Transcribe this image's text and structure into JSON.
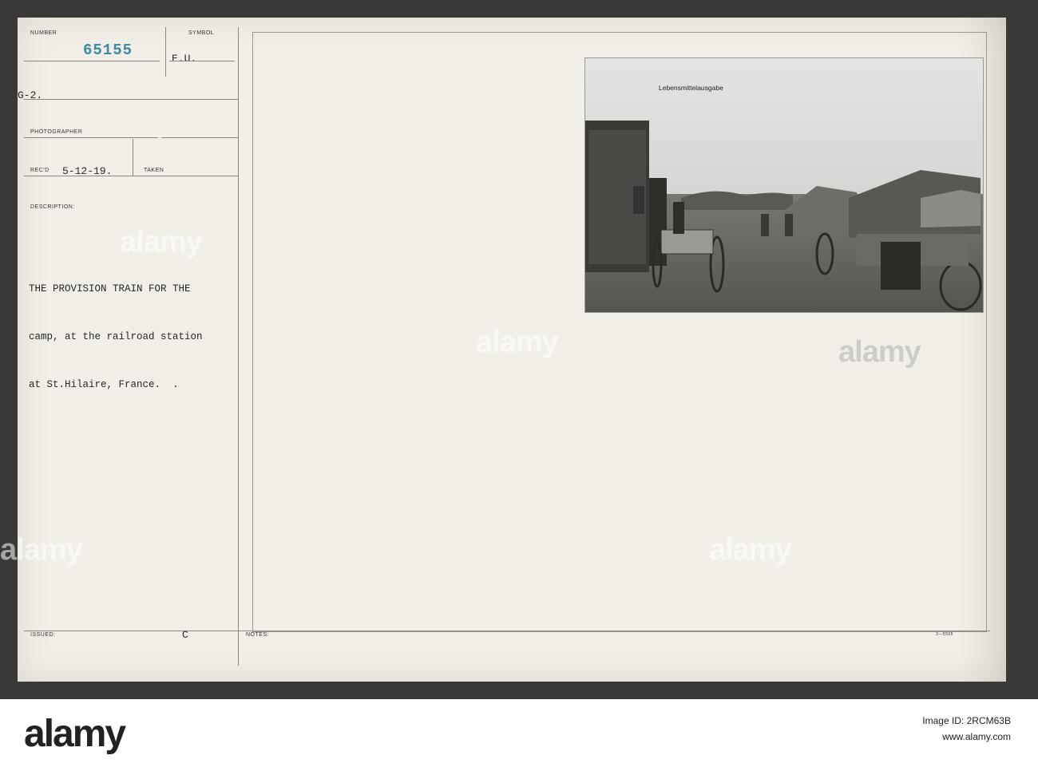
{
  "record": {
    "number_label": "NUMBER",
    "number": "65155",
    "symbol_label": "SYMBOL",
    "symbol": "E.U.",
    "g2": "G-2.",
    "photographer_label": "PHOTOGRAPHER",
    "recd_label": "REC'D",
    "recd_date": "5-12-19.",
    "taken_label": "TAKEN",
    "description_label": "DESCRIPTION:",
    "description_lines": [
      "THE PROVISION TRAIN FOR THE",
      "camp, at the railroad station",
      "at St.Hilaire, France.  ."
    ],
    "issued_label": "ISSUED:",
    "c_mark": "C",
    "notes_label": "NOTES:",
    "form_code": "3—5505"
  },
  "photo": {
    "caption": "Lebensmittelausgabe"
  },
  "watermarks": [
    "alamy",
    "alamy",
    "alamy",
    "alamy",
    "alamy"
  ],
  "footer": {
    "logo": "alamy",
    "image_id": "Image ID: 2RCM63B",
    "site": "www.alamy.com"
  }
}
